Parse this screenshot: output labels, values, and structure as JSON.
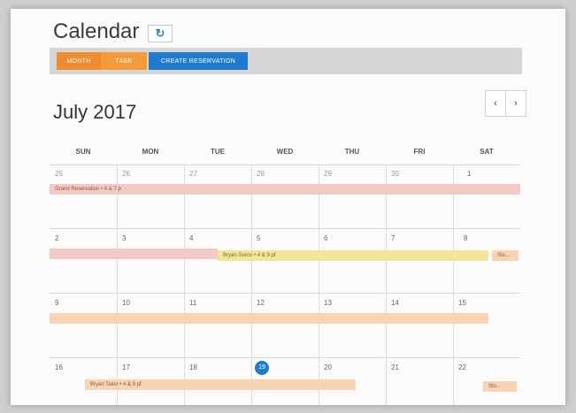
{
  "app": {
    "title": "Calendar",
    "refresh_icon": "↻"
  },
  "toolbar": {
    "month_label": "Month",
    "task_label": "Task",
    "create_label": "Create Reservation"
  },
  "calendar": {
    "month_title": "July 2017",
    "prev": "‹",
    "next": "›",
    "days_of_week": [
      "SUN",
      "MON",
      "TUE",
      "WED",
      "THU",
      "FRI",
      "SAT"
    ],
    "weeks": [
      [
        "25",
        "26",
        "27",
        "28",
        "29",
        "30",
        "1"
      ],
      [
        "2",
        "3",
        "4",
        "5",
        "6",
        "7",
        "8"
      ],
      [
        "9",
        "10",
        "11",
        "12",
        "13",
        "14",
        "15"
      ],
      [
        "16",
        "17",
        "18",
        "19",
        "20",
        "21",
        "22"
      ]
    ],
    "today": "19",
    "events": {
      "e1": "Grand Reservation • 4 & 7 p",
      "e2": "Bryan Durco • 4 & 9 pf",
      "e3": "Bryan Talon • 4 & 9 pf",
      "e4": "Sto...",
      "e5": "Sto..."
    }
  },
  "colors": {
    "month_button": "#f08a2e",
    "task_button": "#f39a3a",
    "create_button": "#1f7bd0",
    "today_marker": "#1f7bd0",
    "event_pink": "#f2c9c4",
    "event_yellow": "#f3e59a",
    "event_peach": "#f6d4b4"
  }
}
